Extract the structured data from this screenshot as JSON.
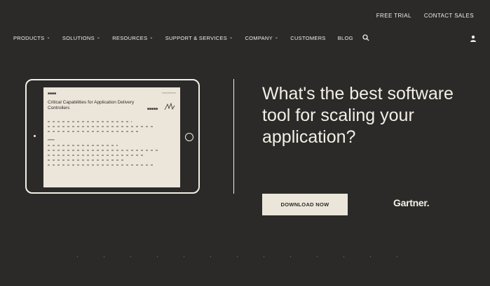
{
  "header": {
    "utility_links": [
      "FREE TRIAL",
      "CONTACT SALES"
    ],
    "nav": [
      {
        "label": "PRODUCTS",
        "dropdown": true
      },
      {
        "label": "SOLUTIONS",
        "dropdown": true
      },
      {
        "label": "RESOURCES",
        "dropdown": true
      },
      {
        "label": "SUPPORT & SERVICES",
        "dropdown": true
      },
      {
        "label": "COMPANY",
        "dropdown": true
      },
      {
        "label": "CUSTOMERS",
        "dropdown": false
      },
      {
        "label": "BLOG",
        "dropdown": false
      }
    ],
    "icons": {
      "search": "search-icon",
      "user": "user-icon"
    }
  },
  "hero": {
    "headline": "What's the best software tool for scaling your application?",
    "cta_label": "DOWNLOAD NOW",
    "partner_logo": "Gartner."
  },
  "report_preview": {
    "title": "Critical Capabilities for Application Delivery Controllers"
  },
  "colors": {
    "background": "#2b2a28",
    "foreground": "#f3efe6",
    "button": "#ece6da"
  }
}
